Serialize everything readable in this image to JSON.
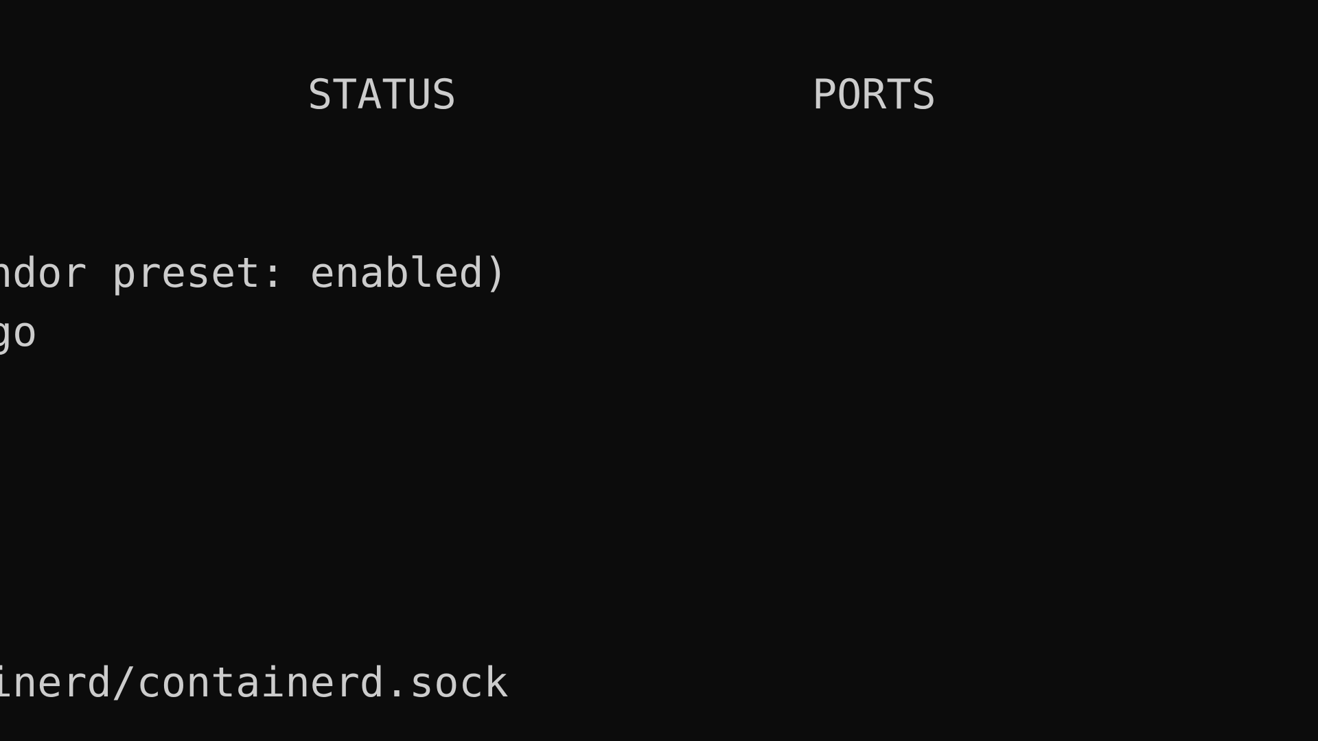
{
  "terminal": {
    "header": {
      "status_label": "STATUS",
      "ports_label": "PORTS"
    },
    "lines": {
      "vendor_preset": "ndor preset: enabled)",
      "ago": "go",
      "socket": "inerd/containerd.sock"
    }
  }
}
